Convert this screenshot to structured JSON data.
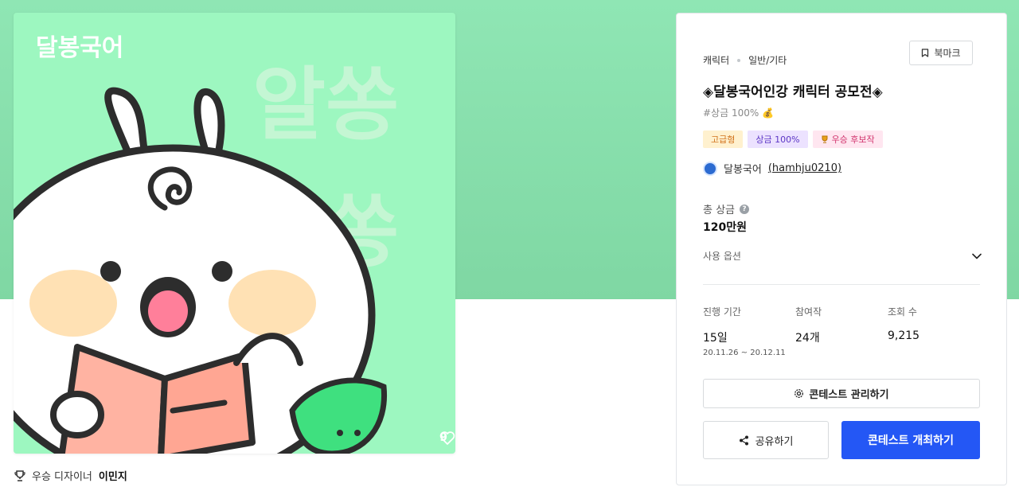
{
  "artwork": {
    "brand_text": "달봉국어",
    "big_text_line1": "알쏭",
    "big_text_line2": "달쏭",
    "like_count": "9"
  },
  "winner": {
    "label": "우승 디자이너",
    "name": "이민지"
  },
  "panel": {
    "category": "캐릭터",
    "subcategory": "일반/기타",
    "bookmark_label": "북마크",
    "title": "◈달봉국어인강 캐릭터 공모전◈",
    "tagline": "#상금 100% 💰",
    "badges": [
      "고급형",
      "상금 100%",
      "우승 후보작"
    ],
    "host_name": "달봉국어",
    "host_id": "(hamhju0210)",
    "prize_label": "총 상금",
    "prize_value": "120만원",
    "usage_label": "사용 옵션",
    "stats": [
      {
        "label": "진행 기간",
        "value": "15일",
        "sub": "20.11.26 ~ 20.12.11"
      },
      {
        "label": "참여작",
        "value": "24개",
        "sub": ""
      },
      {
        "label": "조회 수",
        "value": "9,215",
        "sub": ""
      }
    ],
    "manage_label": "콘테스트 관리하기",
    "share_label": "공유하기",
    "host_contest_label": "콘테스트 개최하기"
  },
  "colors": {
    "hero_bg": "#8fe6b4",
    "art_bg": "#9df7c0",
    "primary": "#2457f5"
  }
}
